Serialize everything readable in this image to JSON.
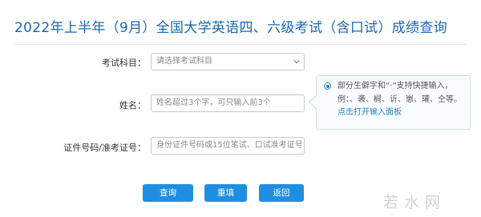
{
  "page": {
    "title": "2022年上半年（9月）全国大学英语四、六级考试（含口试）成绩查询"
  },
  "form": {
    "subject": {
      "label": "考试科目：",
      "value": "请选择考试科目"
    },
    "name": {
      "label": "姓名：",
      "placeholder": "姓名超过3个字，可只输入前3个"
    },
    "id": {
      "label": "证件号码/准考证号：",
      "placeholder": "身份证件号码或15位笔试、口试准考证号"
    }
  },
  "tip": {
    "text": "部分生僻字和“·”支持快捷输入，例：、袭、榈、䜣、崽、瓘、仝等。",
    "link": "点击打开输入面板"
  },
  "buttons": {
    "query": "查询",
    "reset": "重填",
    "back": "返回"
  },
  "watermark": {
    "text": "若水网"
  },
  "colors": {
    "title": "#1b67b3",
    "button": "#1e8fe0",
    "link": "#1e84d6",
    "tip_border": "#c9dcec"
  }
}
